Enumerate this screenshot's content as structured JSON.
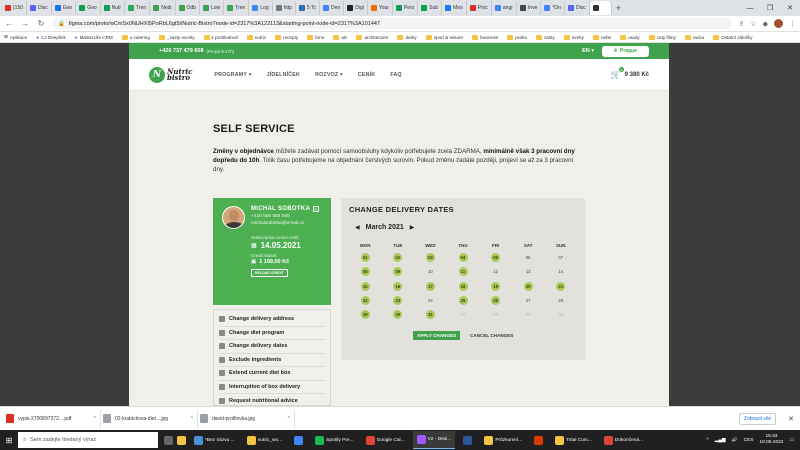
{
  "browser": {
    "tabs": [
      {
        "label": "(150",
        "color": "#d93025"
      },
      {
        "label": "Disc",
        "color": "#5865f2"
      },
      {
        "label": "Goo",
        "color": "#1a73e8"
      },
      {
        "label": "Goo",
        "color": "#0f9d58"
      },
      {
        "label": "Nutr",
        "color": "#0f9d58"
      },
      {
        "label": "Tren",
        "color": "#34a853"
      },
      {
        "label": "Nedi",
        "color": "#3fa34d"
      },
      {
        "label": "Odb",
        "color": "#3fa34d"
      },
      {
        "label": "Low",
        "color": "#3fa34d"
      },
      {
        "label": "Tren",
        "color": "#34a853"
      },
      {
        "label": "Log",
        "color": "#4285f4"
      },
      {
        "label": "http",
        "color": "#777777"
      },
      {
        "label": "5 Tc",
        "color": "#2a6ebb"
      },
      {
        "label": "Den",
        "color": "#4285f4"
      },
      {
        "label": "Digi",
        "color": "#222222"
      },
      {
        "label": "Your",
        "color": "#e8710a"
      },
      {
        "label": "Pers",
        "color": "#0f9d58"
      },
      {
        "label": "Sub",
        "color": "#0f9d58"
      },
      {
        "label": "Mes",
        "color": "#1877f2"
      },
      {
        "label": "Proc",
        "color": "#d93025"
      },
      {
        "label": "angr",
        "color": "#4285f4"
      },
      {
        "label": "Inve",
        "color": "#444444"
      },
      {
        "label": "*On",
        "color": "#4285f4"
      },
      {
        "label": "Disc",
        "color": "#5865f2"
      },
      {
        "label": "",
        "color": "#333333"
      }
    ],
    "active_tab_index": 24,
    "new_tab": "+",
    "window_controls": [
      "—",
      "❐",
      "✕"
    ],
    "nav_buttons": [
      "←",
      "→",
      "↻"
    ],
    "url": "figma.com/proto/wCmSx0NUHXI5PoRbL6gt5l/Nutric-Bistro?node-id=2317%3A122113&starting-point-node-id=2317%3A101447",
    "bookmarks": [
      {
        "label": "Aplikace",
        "kind": "apps"
      },
      {
        "label": "CJ Deeplink",
        "kind": "link"
      },
      {
        "label": "MasterLife CRM",
        "kind": "link"
      },
      {
        "label": "x-catering",
        "kind": "folder"
      },
      {
        "label": "_zasty excely",
        "kind": "folder"
      },
      {
        "label": "k prohlednuti",
        "kind": "folder"
      },
      {
        "label": "nutric",
        "kind": "folder"
      },
      {
        "label": "recepty",
        "kind": "folder"
      },
      {
        "label": "brno",
        "kind": "folder"
      },
      {
        "label": "atc",
        "kind": "folder"
      },
      {
        "label": "architecture",
        "kind": "folder"
      },
      {
        "label": "darky",
        "kind": "folder"
      },
      {
        "label": "sport & leisure",
        "kind": "folder"
      },
      {
        "label": "business",
        "kind": "folder"
      },
      {
        "label": "praha",
        "kind": "folder"
      },
      {
        "label": "zasty",
        "kind": "folder"
      },
      {
        "label": "nveby",
        "kind": "folder"
      },
      {
        "label": "nebe",
        "kind": "folder"
      },
      {
        "label": "urady",
        "kind": "folder"
      },
      {
        "label": "caty filmy",
        "kind": "folder"
      },
      {
        "label": "racka",
        "kind": "folder"
      },
      {
        "label": "Ostatní záložky",
        "kind": "folder"
      }
    ]
  },
  "site": {
    "topbar": {
      "phone": "+420 737 479 608",
      "hours": "(Po-pá 9-17h)",
      "language": "EN ▾",
      "location": "Prague"
    },
    "nav": {
      "logo_line1": "Nutric",
      "logo_line2": "bistro",
      "items": [
        "PROGRAMY ▾",
        "JÍDELNÍČEK",
        "ROZVOZ ▾",
        "CENÍK",
        "FAQ"
      ],
      "cart_count": "1",
      "cart_total": "9 380 Kč"
    },
    "page_title": "SELF SERVICE",
    "intro": {
      "bold1": "Změny v objednávce",
      "text1": " můžete zadávat pomocí samoobsluhy kdykoliv potřebujete zcela ZDARMA, ",
      "bold2": "minimálně však 3 pracovní dny dopředu do 10h",
      "text2": ". Tolik času potřebujeme na objednání čerstvých surovin. Pokud změnu zadáte později, projeví se až za 3 pracovní dny."
    },
    "user_card": {
      "name": "MICHAL SOBOTKA",
      "phone": "+420 555 555 555",
      "email": "michalsobotka@email.cz",
      "subscription_label": "Subscription active until:",
      "subscription_date": "14.05.2021",
      "credit_label": "Credit status:",
      "credit_value": "1 199,00 Kč",
      "reload_label": "RELOAD CREDIT"
    },
    "menu": [
      "Change delivery address",
      "Change diet program",
      "Change delivery dates",
      "Exclude ingredients",
      "Extend current diet box",
      "Interruption of box delivery",
      "Request nutritional advice"
    ],
    "calendar": {
      "title": "CHANGE DELIVERY DATES",
      "month": "March 2021",
      "prev": "◀",
      "next": "▶",
      "weekdays": [
        "MON",
        "TUE",
        "WED",
        "THU",
        "FRI",
        "SAT",
        "SUN"
      ],
      "weeks": [
        [
          {
            "d": "01",
            "s": "sel"
          },
          {
            "d": "02",
            "s": "sel"
          },
          {
            "d": "03",
            "s": "sel"
          },
          {
            "d": "04",
            "s": "sel"
          },
          {
            "d": "05",
            "s": "sel"
          },
          {
            "d": "06",
            "s": "n"
          },
          {
            "d": "07",
            "s": "n"
          }
        ],
        [
          {
            "d": "08",
            "s": "sel"
          },
          {
            "d": "09",
            "s": "sel"
          },
          {
            "d": "10",
            "s": "n"
          },
          {
            "d": "11",
            "s": "sel"
          },
          {
            "d": "12",
            "s": "n"
          },
          {
            "d": "13",
            "s": "n"
          },
          {
            "d": "14",
            "s": "n"
          }
        ],
        [
          {
            "d": "15",
            "s": "sel"
          },
          {
            "d": "16",
            "s": "sel"
          },
          {
            "d": "17",
            "s": "sel"
          },
          {
            "d": "18",
            "s": "sel"
          },
          {
            "d": "19",
            "s": "sel"
          },
          {
            "d": "20",
            "s": "sel"
          },
          {
            "d": "21",
            "s": "sel"
          }
        ],
        [
          {
            "d": "22",
            "s": "sel"
          },
          {
            "d": "23",
            "s": "sel"
          },
          {
            "d": "24",
            "s": "n"
          },
          {
            "d": "25",
            "s": "sel"
          },
          {
            "d": "26",
            "s": "sel"
          },
          {
            "d": "27",
            "s": "n"
          },
          {
            "d": "28",
            "s": "n"
          }
        ],
        [
          {
            "d": "29",
            "s": "sel"
          },
          {
            "d": "30",
            "s": "sel"
          },
          {
            "d": "31",
            "s": "sel"
          },
          {
            "d": "01",
            "s": "dis"
          },
          {
            "d": "02",
            "s": "dis"
          },
          {
            "d": "03",
            "s": "dis"
          },
          {
            "d": "04",
            "s": "dis"
          }
        ]
      ],
      "apply": "APPLY CHANGES",
      "cancel": "CANCEL CHANGES"
    }
  },
  "downloads": {
    "items": [
      {
        "label": "vypis-2700897372....pdf",
        "color": "#d93025"
      },
      {
        "label": "02-krabickova-diet....jpg",
        "color": "#9aa0a6"
      },
      {
        "label": "david-profilovka.jpg",
        "color": "#9aa0a6"
      }
    ],
    "show_all": "Zobrazit vše",
    "close": "✕"
  },
  "taskbar": {
    "search_placeholder": "Sem zadejte hledaný výraz",
    "apps": [
      {
        "label": "*Bez názvu ...",
        "color": "#4a90d9"
      },
      {
        "label": "nutric_wo...",
        "color": "#f4c542"
      },
      {
        "label": "",
        "color": "#4285f4"
      },
      {
        "label": "Spotify Pre...",
        "color": "#1db954"
      },
      {
        "label": "Google Cal...",
        "color": "#db4437"
      },
      {
        "label": "V2 - Desi...",
        "color": "#a259ff"
      },
      {
        "label": "",
        "color": "#2b579a"
      },
      {
        "label": "Průzkumní...",
        "color": "#f4c542"
      },
      {
        "label": "",
        "color": "#d83b01"
      },
      {
        "label": "Total Com...",
        "color": "#f4c542"
      },
      {
        "label": "Dokončená...",
        "color": "#db4437"
      }
    ],
    "lang": "CES",
    "time": "15:43",
    "date": "10.08.2022"
  }
}
